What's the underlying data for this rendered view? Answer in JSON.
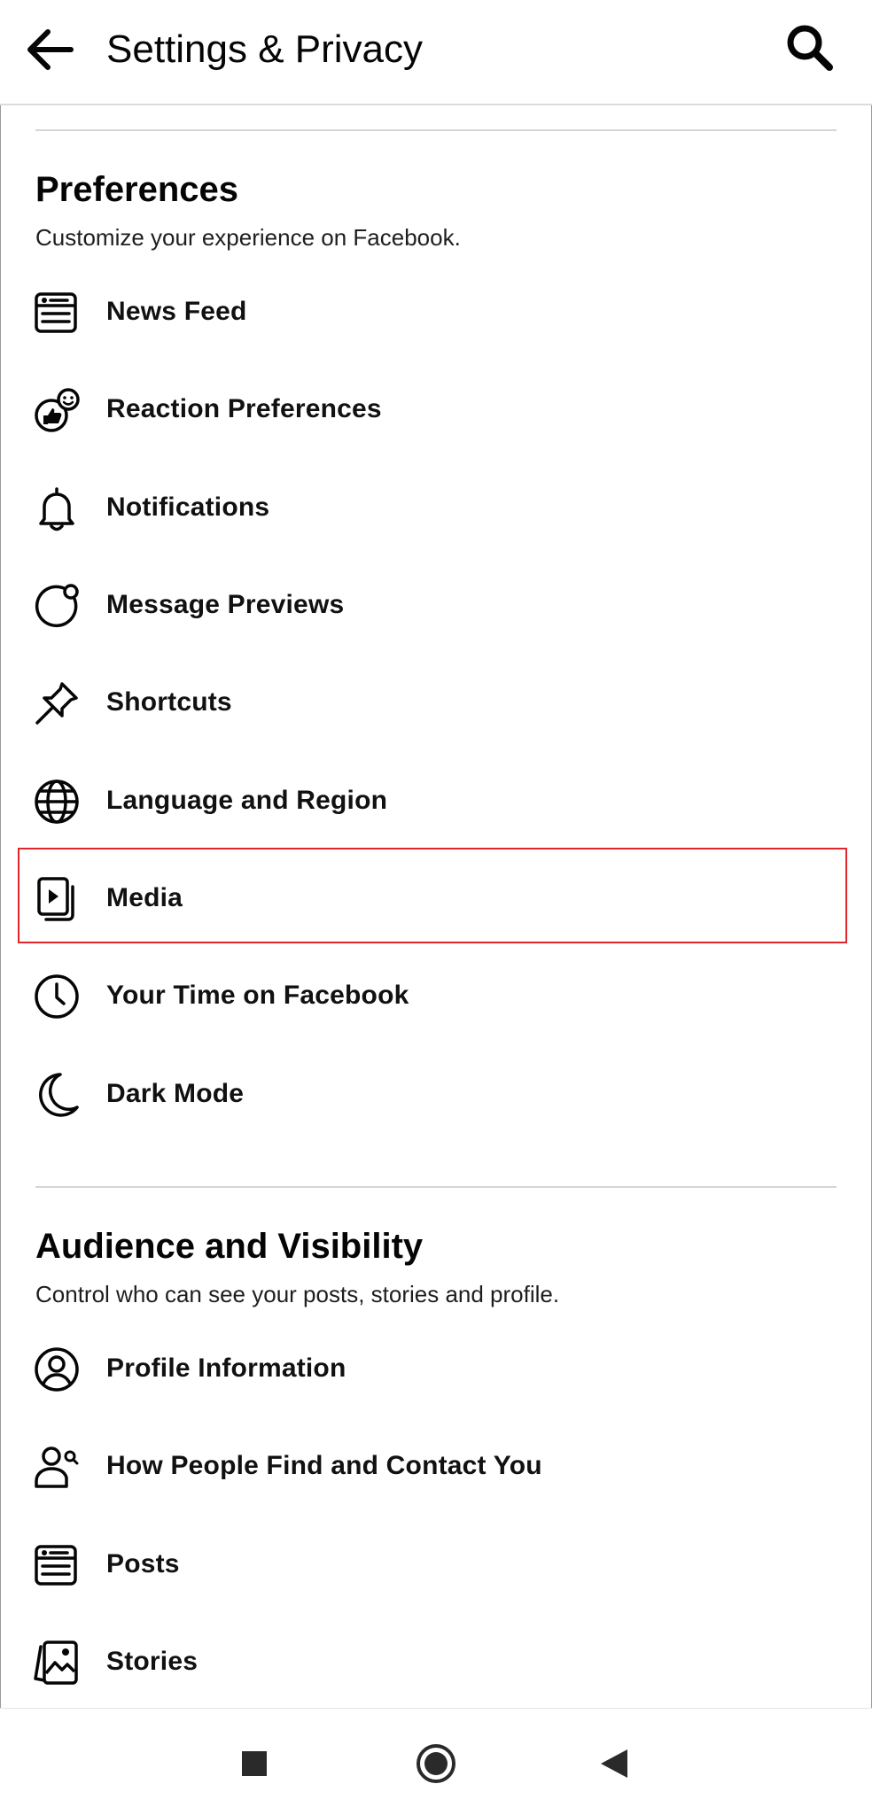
{
  "header": {
    "title": "Settings & Privacy",
    "back_icon": "arrow-left-icon",
    "search_icon": "search-icon"
  },
  "preferences": {
    "title": "Preferences",
    "subtitle": "Customize your experience on Facebook.",
    "items": [
      {
        "label": "News Feed",
        "icon": "news-feed-icon"
      },
      {
        "label": "Reaction Preferences",
        "icon": "reaction-icon"
      },
      {
        "label": "Notifications",
        "icon": "bell-icon"
      },
      {
        "label": "Message Previews",
        "icon": "message-preview-icon"
      },
      {
        "label": "Shortcuts",
        "icon": "pin-icon"
      },
      {
        "label": "Language and Region",
        "icon": "globe-icon"
      },
      {
        "label": "Media",
        "icon": "media-icon",
        "highlighted": true
      },
      {
        "label": "Your Time on Facebook",
        "icon": "clock-icon"
      },
      {
        "label": "Dark Mode",
        "icon": "moon-icon"
      }
    ]
  },
  "audience": {
    "title": "Audience and Visibility",
    "subtitle": "Control who can see your posts, stories and profile.",
    "items": [
      {
        "label": "Profile Information",
        "icon": "profile-icon"
      },
      {
        "label": "How People Find and Contact You",
        "icon": "find-people-icon"
      },
      {
        "label": "Posts",
        "icon": "posts-icon"
      },
      {
        "label": "Stories",
        "icon": "stories-icon"
      }
    ]
  },
  "navbar": {
    "recents_icon": "square-icon",
    "home_icon": "home-circle-icon",
    "back_icon": "triangle-back-icon"
  },
  "colors": {
    "highlight": "#e0262b",
    "text": "#050505",
    "divider": "#d6d6d6"
  }
}
